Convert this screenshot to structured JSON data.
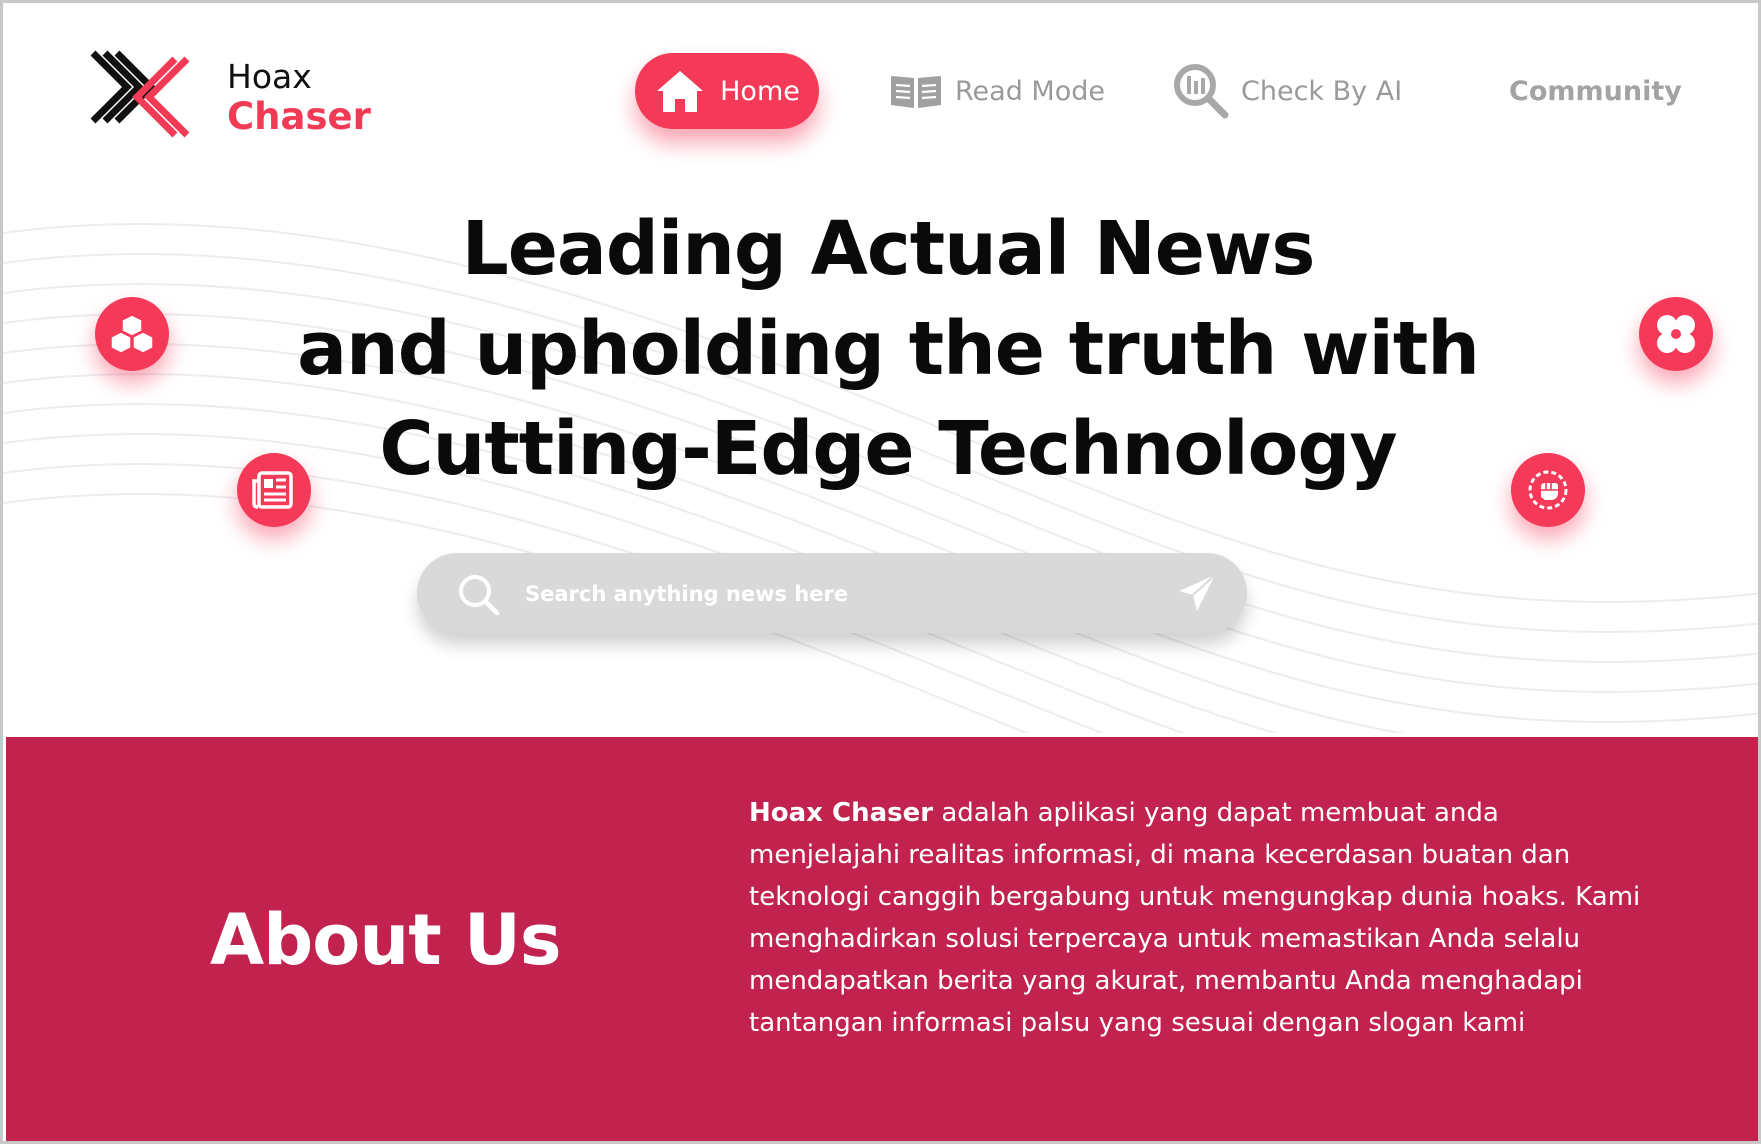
{
  "brand": {
    "line1": "Hoax",
    "line2": "Chaser",
    "accent": "#f43a58"
  },
  "nav": {
    "home": "Home",
    "read_mode": "Read Mode",
    "check_by_ai": "Check By AI",
    "community": "Community"
  },
  "hero": {
    "line1": "Leading Actual News",
    "line2": "and upholding the truth with",
    "line3": "Cutting-Edge Technology",
    "icons": [
      "cubes-icon",
      "newspaper-icon",
      "pinwheel-icon",
      "fist-icon"
    ]
  },
  "search": {
    "placeholder": "Search anything news here"
  },
  "about": {
    "title": "About Us",
    "brand_bold": "Hoax Chaser",
    "body": "adalah aplikasi yang dapat membuat anda menjelajahi realitas informasi, di mana kecerdasan buatan dan teknologi canggih bergabung untuk mengungkap dunia hoaks. Kami menghadirkan solusi terpercaya untuk memastikan Anda selalu mendapatkan berita yang akurat, membantu Anda menghadapi tantangan informasi palsu yang sesuai dengan slogan kami",
    "background": "#c1234e"
  }
}
